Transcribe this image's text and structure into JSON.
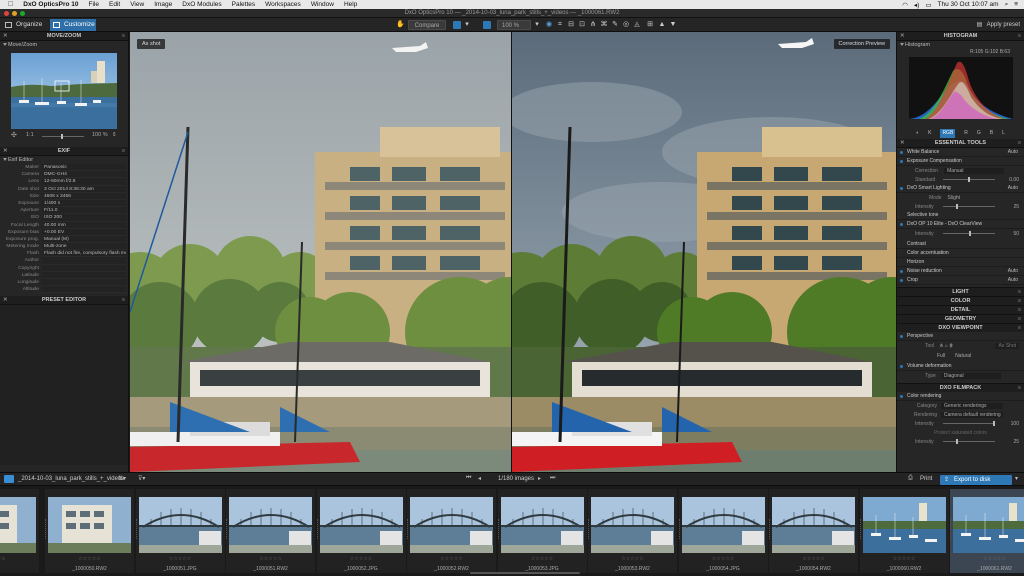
{
  "menubar": {
    "app_name": "DxO OpticsPro 10",
    "items": [
      "File",
      "Edit",
      "View",
      "Image",
      "DxO Modules",
      "Palettes",
      "Workspaces",
      "Window",
      "Help"
    ],
    "clock": "Thu 30 Oct  10:07 am"
  },
  "window": {
    "title": "DxO OpticsPro 10 — _2014-10-03_luna_park_stills_+_videos — _1000061.RW2"
  },
  "toolbar": {
    "organize_label": "Organize",
    "customize_label": "Customize",
    "compare_label": "Compare",
    "zoom_level": "100 %",
    "apply_preset_label": "Apply preset"
  },
  "left_panel": {
    "move_zoom": {
      "title": "MOVE/ZOOM",
      "sub_title": "Move/Zoom",
      "ratio_label": "1:1",
      "zoom_value": "100 %"
    },
    "exif": {
      "title": "EXIF",
      "sub_title": "Exif Editor",
      "rows": [
        {
          "label": "Maker",
          "value": "Panasonic"
        },
        {
          "label": "Camera",
          "value": "DMC-GH4"
        },
        {
          "label": "Lens",
          "value": "12-60mm f/2.8"
        },
        {
          "label": "Date shot",
          "value": "3 Oct 2014 8:36:30 am"
        },
        {
          "label": "Size",
          "value": "4608 x 3456"
        },
        {
          "label": "Exposure",
          "value": "1/400 s"
        },
        {
          "label": "Aperture",
          "value": "F/11.0"
        },
        {
          "label": "ISO",
          "value": "ISO 200"
        },
        {
          "label": "Focal Length",
          "value": "40.00 mm"
        },
        {
          "label": "Exposure bias",
          "value": "+0.00 EV"
        },
        {
          "label": "Exposure prog.",
          "value": "Manual (M)"
        },
        {
          "label": "Metering mode",
          "value": "Multi-zone"
        },
        {
          "label": "Flash",
          "value": "Flash did not fire, compulsory flash mode"
        },
        {
          "label": "Author",
          "value": ""
        },
        {
          "label": "Copyright",
          "value": ""
        },
        {
          "label": "Latitude",
          "value": ""
        },
        {
          "label": "Longitude",
          "value": ""
        },
        {
          "label": "Altitude",
          "value": ""
        }
      ]
    },
    "preset_editor": {
      "title": "PRESET EDITOR"
    }
  },
  "viewer": {
    "left_label": "As shot",
    "right_label": "Correction Preview"
  },
  "right_panel": {
    "histogram": {
      "title": "HISTOGRAM",
      "sub_title": "Histogram",
      "readout": "R:105 G:102 B:63",
      "channels": [
        "K",
        "RGB",
        "R",
        "G",
        "B",
        "L"
      ],
      "active_channel": "RGB"
    },
    "essential_tools": {
      "title": "ESSENTIAL TOOLS",
      "white_balance": "White Balance",
      "white_balance_value": "Auto",
      "exposure_compensation": "Exposure Compensation",
      "correction_label": "Correction",
      "correction_value": "Manual",
      "standard_label": "Standard",
      "standard_value": "0.00",
      "smart_lighting": "DxO Smart Lighting",
      "smart_lighting_value": "Auto",
      "mode_label": "Mode",
      "mode_value": "Slight",
      "sl_intensity_label": "Intensity",
      "sl_intensity_value": "25",
      "selective_tone": "Selective tone",
      "clearview": "DxO OP 10 Elite - DxO ClearView",
      "cv_intensity_label": "Intensity",
      "cv_intensity_value": "50",
      "contrast": "Contrast",
      "color_accentuation": "Color accentuation",
      "horizon": "Horizon",
      "noise_reduction": "Noise reduction",
      "noise_reduction_value": "Auto",
      "crop": "Crop",
      "crop_value": "Auto"
    },
    "light": "LIGHT",
    "color": "COLOR",
    "detail": "DETAIL",
    "geometry": "GEOMETRY",
    "viewpoint": {
      "title": "DXO VIEWPOINT",
      "perspective": "Perspective",
      "tool_label": "Tool",
      "as_shot_label": "As Shot",
      "full_label": "Full",
      "natural_label": "Natural",
      "volume_deformation": "Volume deformation",
      "type_label": "Type",
      "type_value": "Diagonal"
    },
    "filmpack": {
      "title": "DXO FILMPACK",
      "color_rendering": "Color rendering",
      "category_label": "Category",
      "category_value": "Generic renderings",
      "rendering_label": "Rendering",
      "rendering_value": "Camera default rendering",
      "intensity_label": "Intensity",
      "intensity_value": "100",
      "protect_label": "Protect saturated colors",
      "protect_intensity_label": "Intensity",
      "protect_intensity_value": "25"
    }
  },
  "filmbar": {
    "folder": "_2014-10-03_luna_park_stills_+_videos",
    "image_count": "1/180 images",
    "print_label": "Print",
    "export_label": "Export to disk"
  },
  "filmstrip": [
    {
      "name": "",
      "scene": "building"
    },
    {
      "name": "_1000050.RW2",
      "scene": "building"
    },
    {
      "name": "_1000051.JPG",
      "scene": "bridge"
    },
    {
      "name": "_1000051.RW2",
      "scene": "bridge"
    },
    {
      "name": "_1000052.JPG",
      "scene": "bridge"
    },
    {
      "name": "_1000052.RW2",
      "scene": "bridge"
    },
    {
      "name": "_1000053.JPG",
      "scene": "bridge"
    },
    {
      "name": "_1000053.RW2",
      "scene": "bridge"
    },
    {
      "name": "_1000054.JPG",
      "scene": "bridge"
    },
    {
      "name": "_1000054.RW2",
      "scene": "bridge"
    },
    {
      "name": "_1000060.RW2",
      "scene": "marina"
    },
    {
      "name": "_1000061.RW2",
      "scene": "marina"
    }
  ],
  "colors": {
    "accent": "#2d78b5",
    "panel": "#262626"
  }
}
